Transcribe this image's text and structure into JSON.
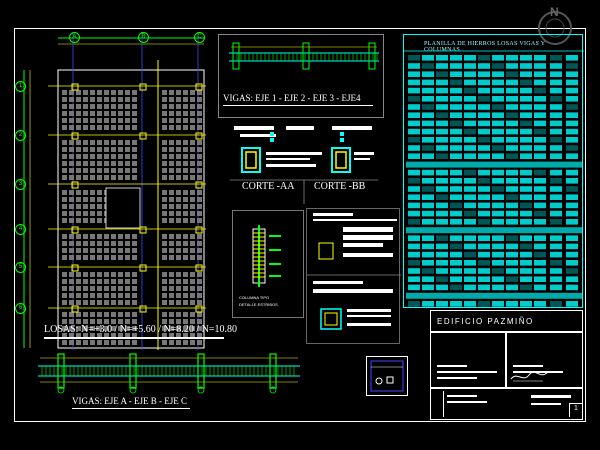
{
  "sheet": {
    "losas_label": "LOSAS:  N=+3.0 /  N=+5.60 /  N=8.20 /  N=10.80",
    "vigas_top_label": "VIGAS:  EJE 1 - EJE 2 - EJE 3  - EJE4",
    "vigas_bottom_label": "VIGAS: EJE A - EJE B - EJE C",
    "corte_aa": "CORTE -AA",
    "corte_bb": "CORTE -BB",
    "column_label_1": "COLUMNA TIPO",
    "column_label_2": "DETALLE ESTRIBOS",
    "table_title": "PLANILLA DE HIERROS LOSAS VIGAS Y COLUMNAS",
    "building_name": "EDIFICIO PAZMIÑO",
    "sheet_number": "1"
  },
  "grid": {
    "columns": [
      "A",
      "B",
      "C"
    ],
    "rows": [
      "1",
      "2",
      "3",
      "4",
      "5",
      "6"
    ]
  },
  "compass": {
    "north": "N"
  },
  "colors": {
    "background": "#000000",
    "frame": "#ffffff",
    "cyan": "#00ffff",
    "yellow": "#ffff00",
    "green": "#00ff00",
    "blue": "#0000ff",
    "red": "#ff0000"
  }
}
